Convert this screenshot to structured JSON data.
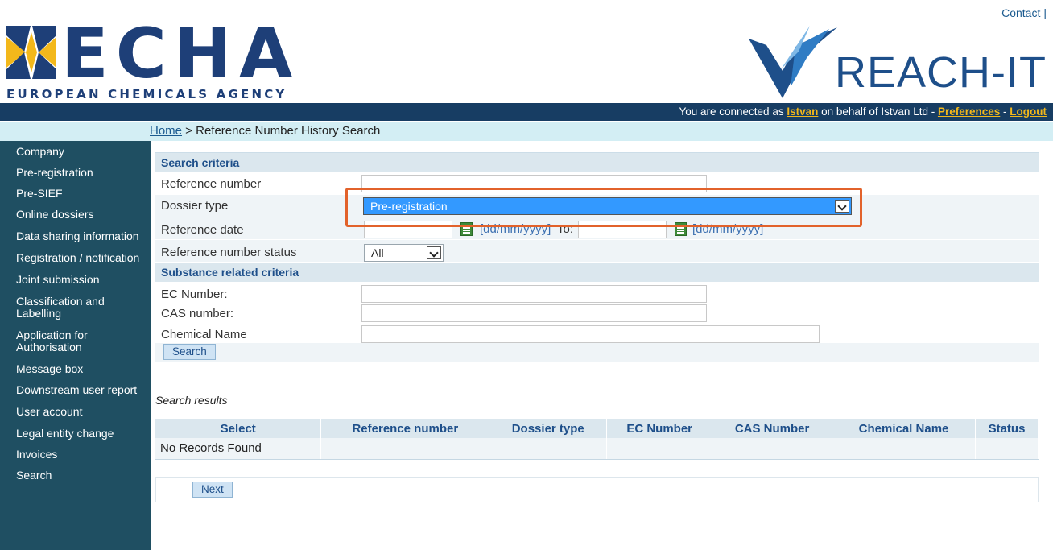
{
  "header": {
    "contact_label": "Contact",
    "contact_sep": "|",
    "echa_word": "ECHA",
    "echa_subtitle": "EUROPEAN CHEMICALS AGENCY",
    "reach_word": "REACH-IT"
  },
  "userbar": {
    "prefix": "You are connected as ",
    "user": "Istvan",
    "behalf": " on behalf of Istvan Ltd - ",
    "preferences": "Preferences",
    "dash": " - ",
    "logout": "Logout"
  },
  "breadcrumb": {
    "home": "Home",
    "separator": " > ",
    "current": "Reference Number History Search"
  },
  "sidebar": {
    "items": [
      "Company",
      "Pre-registration",
      "Pre-SIEF",
      "Online dossiers",
      "Data sharing information",
      "Registration / notification",
      "Joint submission",
      "Classification and Labelling",
      "Application for Authorisation",
      "Message box",
      "Downstream user report",
      "User account",
      "Legal entity change",
      "Invoices",
      "Search"
    ]
  },
  "form": {
    "search_criteria_title": "Search criteria",
    "reference_number_label": "Reference number",
    "reference_number_value": "",
    "dossier_type_label": "Dossier type",
    "dossier_type_value": "Pre-registration",
    "reference_date_label": "Reference date",
    "date_hint": "[dd/mm/yyyy]",
    "to_label": "To:",
    "status_label": "Reference number status",
    "status_value": "All",
    "substance_title": "Substance related criteria",
    "ec_label": "EC Number:",
    "cas_label": "CAS number:",
    "chemical_label": "Chemical Name",
    "search_button": "Search"
  },
  "results": {
    "label": "Search results",
    "columns": [
      "Select",
      "Reference number",
      "Dossier type",
      "EC Number",
      "CAS Number",
      "Chemical Name",
      "Status"
    ],
    "empty_message": "No Records Found",
    "next_button": "Next"
  },
  "colors": {
    "brand_navy": "#173d63",
    "sidebar": "#1f4f62",
    "highlight": "#e2622b",
    "echa_gold": "#f3b81b"
  }
}
